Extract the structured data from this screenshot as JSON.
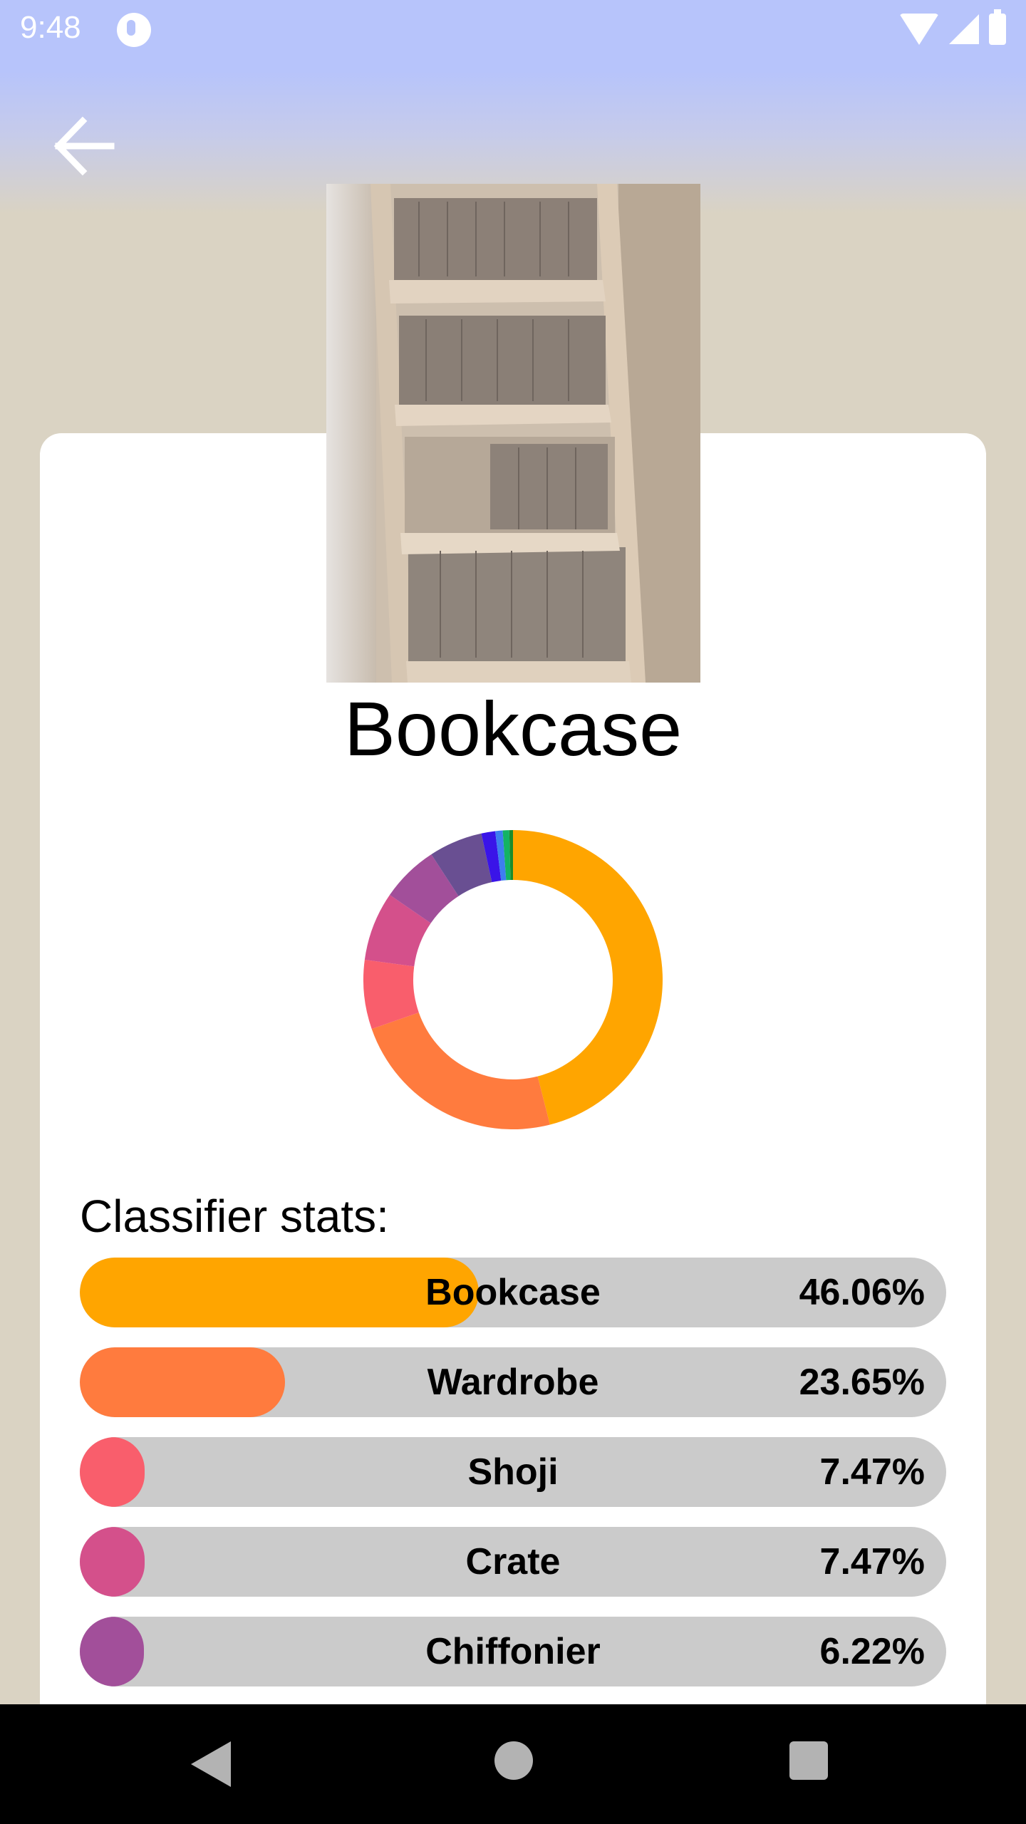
{
  "status_bar": {
    "time": "9:48",
    "icons": [
      "app-notification-icon",
      "wifi-icon",
      "cell-signal-icon",
      "battery-icon"
    ]
  },
  "header": {
    "back_icon": "arrow-left-icon"
  },
  "photo": {
    "subject": "bookcase"
  },
  "result": {
    "label": "Bookcase"
  },
  "stats": {
    "heading": "Classifier stats:",
    "items": [
      {
        "label": "Bookcase",
        "percent_text": "46.06%",
        "value": 46.06,
        "color": "#ffa500"
      },
      {
        "label": "Wardrobe",
        "percent_text": "23.65%",
        "value": 23.65,
        "color": "#ff7b3e"
      },
      {
        "label": "Shoji",
        "percent_text": "7.47%",
        "value": 7.47,
        "color": "#f95e6c"
      },
      {
        "label": "Crate",
        "percent_text": "7.47%",
        "value": 7.47,
        "color": "#d4508b"
      },
      {
        "label": "Chiffonier",
        "percent_text": "6.22%",
        "value": 6.22,
        "color": "#a24f9a"
      }
    ]
  },
  "chart_data": {
    "type": "pie",
    "style": "donut",
    "categories": [
      "Bookcase",
      "Wardrobe",
      "Shoji",
      "Crate",
      "Chiffonier",
      "",
      "",
      "",
      "",
      ""
    ],
    "values": [
      46.06,
      23.65,
      7.47,
      7.47,
      6.22,
      5.8,
      1.5,
      0.8,
      0.7,
      0.4
    ],
    "colors": [
      "#ffa500",
      "#ff7b3e",
      "#f95e6c",
      "#d4508b",
      "#a24f9a",
      "#694f92",
      "#3a14e8",
      "#3d7ef0",
      "#13b364",
      "#1a8c2c"
    ]
  },
  "nav_bar": {
    "icons": [
      "nav-back-icon",
      "nav-home-icon",
      "nav-recents-icon"
    ]
  }
}
